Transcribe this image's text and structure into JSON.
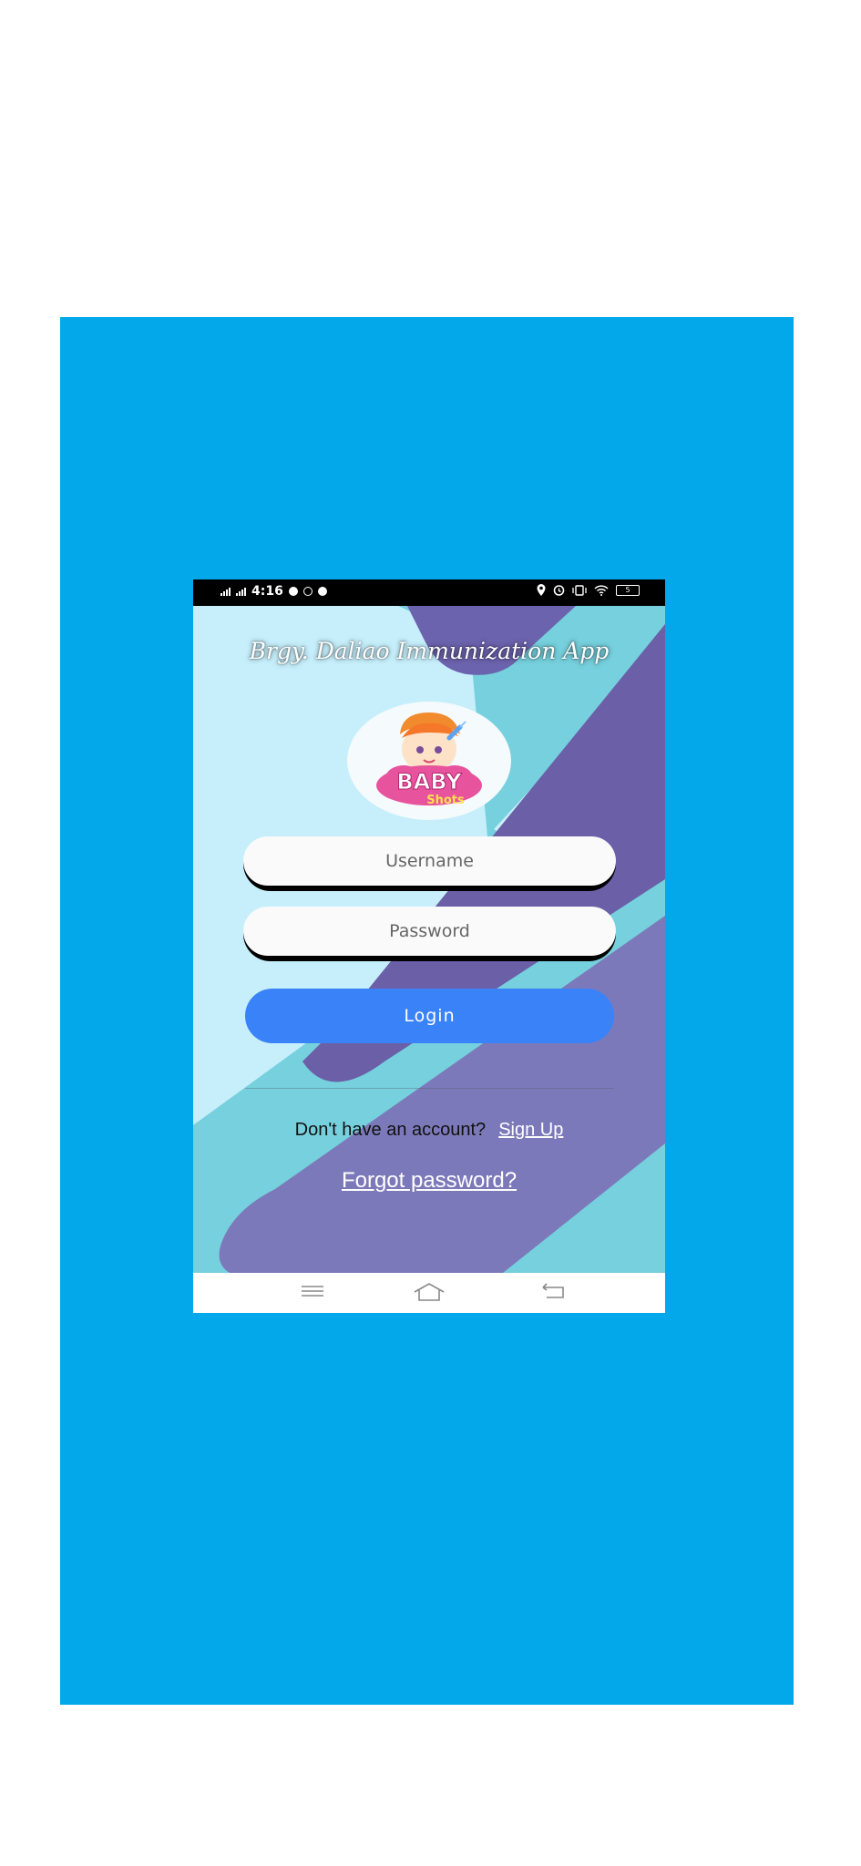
{
  "status_bar": {
    "time": "4:16",
    "battery": "5"
  },
  "app": {
    "title": "Brgy. Daliao Immunization App",
    "logo": {
      "line1": "BABY",
      "line2": "Shots"
    }
  },
  "form": {
    "username_placeholder": "Username",
    "password_placeholder": "Password",
    "login_label": "Login"
  },
  "signup": {
    "prompt": "Don't have an account?",
    "link": "Sign Up"
  },
  "forgot_password": "Forgot password?",
  "colors": {
    "page_background": "#02a8ea",
    "accent_button": "#3a82f7",
    "light_background": "#c6effb",
    "purple_band": "#6b62ad",
    "teal_band": "#76d0dd"
  },
  "icons": [
    "signal-icon",
    "messenger-icon",
    "facebook-icon",
    "location-icon",
    "alarm-icon",
    "vibrate-icon",
    "wifi-icon",
    "battery-icon",
    "menu-icon",
    "home-icon",
    "back-icon"
  ]
}
